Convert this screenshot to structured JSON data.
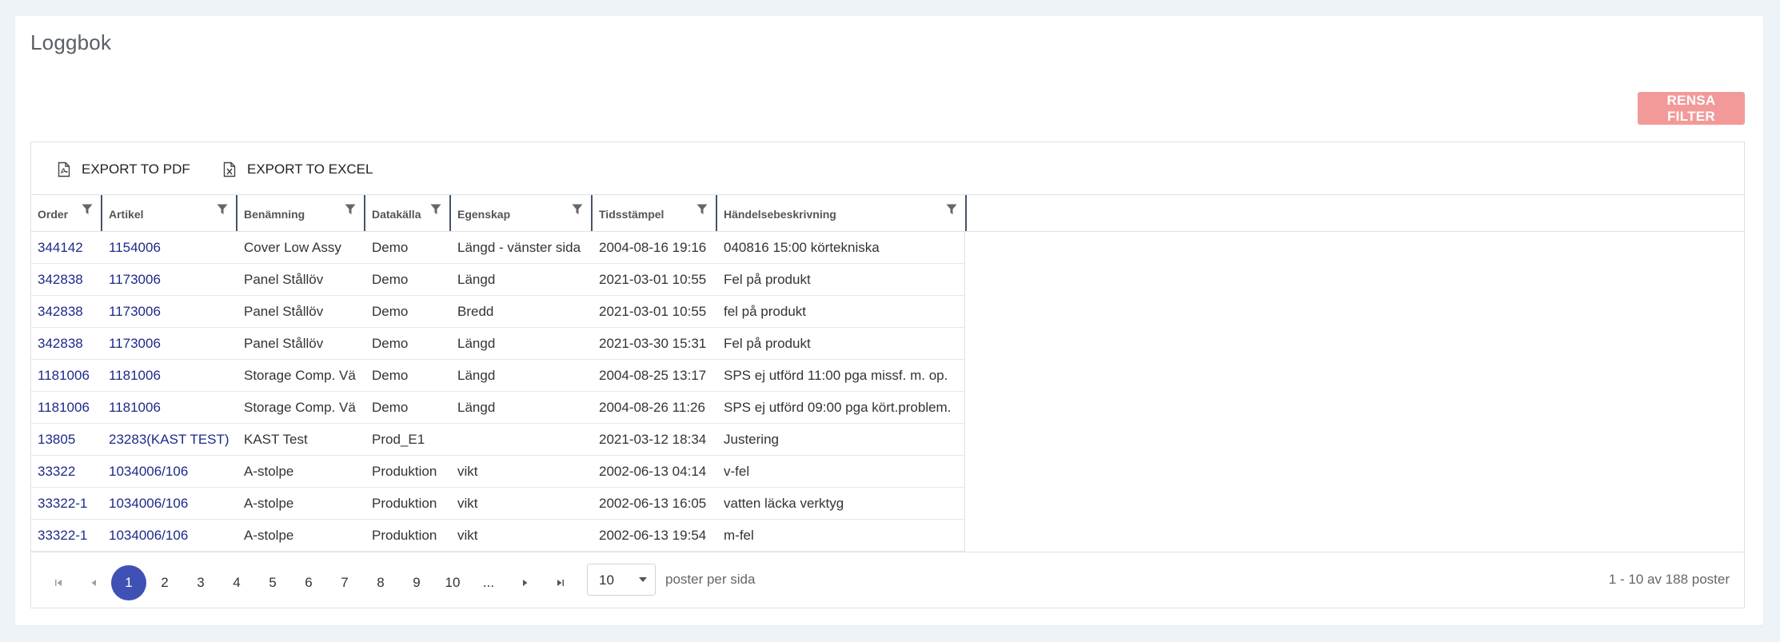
{
  "page": {
    "title": "Loggbok"
  },
  "actions": {
    "clear_filter": "RENSA FILTER"
  },
  "toolbar": {
    "export_pdf": "EXPORT TO PDF",
    "export_excel": "EXPORT TO EXCEL"
  },
  "columns": [
    "Order",
    "Artikel",
    "Benämning",
    "Datakälla",
    "Egenskap",
    "Tidsstämpel",
    "Händelsebeskrivning"
  ],
  "rows": [
    [
      "344142",
      "1154006",
      "Cover Low Assy",
      "Demo",
      "Längd - vänster sida",
      "2004-08-16 19:16",
      "040816 15:00 körtekniska"
    ],
    [
      "342838",
      "1173006",
      "Panel Stållöv",
      "Demo",
      "Längd",
      "2021-03-01 10:55",
      "Fel på produkt"
    ],
    [
      "342838",
      "1173006",
      "Panel Stållöv",
      "Demo",
      "Bredd",
      "2021-03-01 10:55",
      "fel på produkt"
    ],
    [
      "342838",
      "1173006",
      "Panel Stållöv",
      "Demo",
      "Längd",
      "2021-03-30 15:31",
      "Fel på produkt"
    ],
    [
      "1181006",
      "1181006",
      "Storage Comp. Vä",
      "Demo",
      "Längd",
      "2004-08-25 13:17",
      "SPS ej utförd 11:00 pga missf. m. op."
    ],
    [
      "1181006",
      "1181006",
      "Storage Comp. Vä",
      "Demo",
      "Längd",
      "2004-08-26 11:26",
      "SPS ej utförd 09:00 pga kört.problem."
    ],
    [
      "13805",
      "23283(KAST TEST)",
      "KAST Test",
      "Prod_E1",
      "",
      "2021-03-12 18:34",
      "Justering"
    ],
    [
      "33322",
      "1034006/106",
      "A-stolpe",
      "Produktion",
      "vikt",
      "2002-06-13 04:14",
      "v-fel"
    ],
    [
      "33322-1",
      "1034006/106",
      "A-stolpe",
      "Produktion",
      "vikt",
      "2002-06-13 16:05",
      "vatten läcka verktyg"
    ],
    [
      "33322-1",
      "1034006/106",
      "A-stolpe",
      "Produktion",
      "vikt",
      "2002-06-13 19:54",
      "m-fel"
    ]
  ],
  "pager": {
    "pages": [
      "1",
      "2",
      "3",
      "4",
      "5",
      "6",
      "7",
      "8",
      "9",
      "10",
      "..."
    ],
    "active_page": "1",
    "page_size": "10",
    "per_page_label": "poster per sida",
    "info": "1 - 10 av 188 poster"
  },
  "colors": {
    "accent": "#3f51b5",
    "danger_button": "#f29a9a",
    "link": "#1d2a8a"
  },
  "icons": {
    "export_pdf": "pdf-file-icon",
    "export_excel": "excel-file-icon",
    "filter": "filter-icon"
  }
}
